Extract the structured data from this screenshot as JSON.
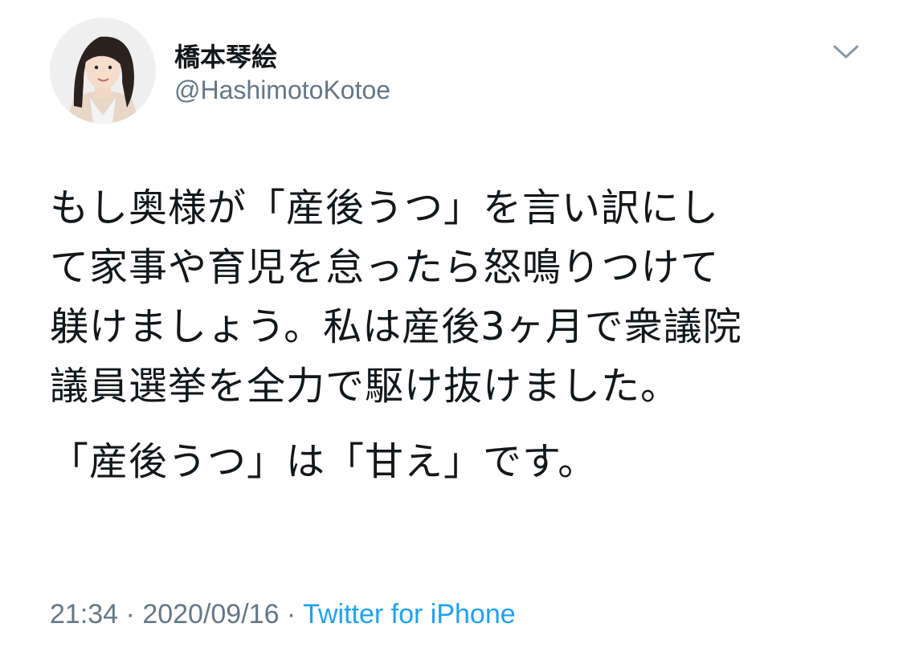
{
  "user": {
    "display_name": "橋本琴絵",
    "handle": "@HashimotoKotoe"
  },
  "tweet": {
    "lines": [
      "もし奥様が「産後うつ」を言い訳にし",
      "て家事や育児を怠ったら怒鳴りつけて",
      "躾けましょう。私は産後3ヶ月で衆議院",
      "議員選挙を全力で駆け抜けました。"
    ],
    "second_paragraph": "「産後うつ」は「甘え」です。"
  },
  "meta": {
    "time": "21:34",
    "date": "2020/09/16",
    "separator": " · ",
    "source": "Twitter for iPhone"
  },
  "colors": {
    "text": "#14171a",
    "secondary": "#657786",
    "link": "#1da1f2"
  },
  "icons": {
    "menu": "chevron-down-icon"
  }
}
